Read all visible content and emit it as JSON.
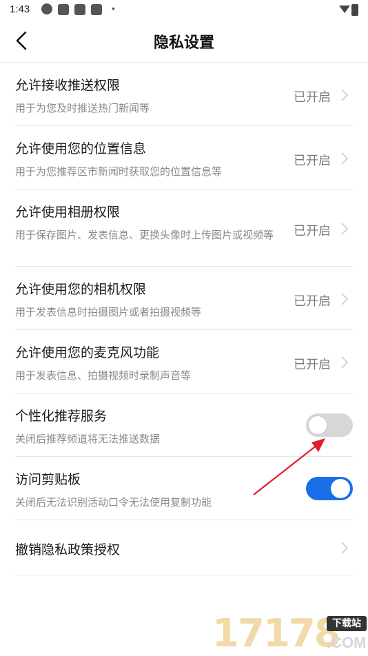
{
  "status_bar": {
    "time": "1:43",
    "dot": "•"
  },
  "header": {
    "title": "隐私设置"
  },
  "settings": [
    {
      "title": "允许接收推送权限",
      "desc": "用于为您及时推送热门新闻等",
      "status": "已开启"
    },
    {
      "title": "允许使用您的位置信息",
      "desc": "用于为您推荐区市新闻时获取您的位置信息等",
      "status": "已开启"
    },
    {
      "title": "允许使用相册权限",
      "desc": "用于保存图片、发表信息、更换头像时上传图片或视频等",
      "status": "已开启"
    },
    {
      "title": "允许使用您的相机权限",
      "desc": "用于发表信息时拍摄图片或者拍摄视频等",
      "status": "已开启"
    },
    {
      "title": "允许使用您的麦克风功能",
      "desc": "用于发表信息、拍摄视频时录制声音等",
      "status": "已开启"
    },
    {
      "title": "个性化推荐服务",
      "desc": "关闭后推荐频道将无法推送数据",
      "toggle": "off"
    },
    {
      "title": "访问剪贴板",
      "desc": "关闭后无法识别活动口令无法使用复制功能",
      "toggle": "on"
    },
    {
      "title": "撤销隐私政策授权"
    }
  ],
  "watermark": {
    "digits": "17178",
    "badge": "下载站",
    "suffix": ".COM"
  },
  "colors": {
    "toggle_on": "#1a6fe8",
    "toggle_off": "#d7d7d7",
    "arrow": "#e0202a"
  }
}
